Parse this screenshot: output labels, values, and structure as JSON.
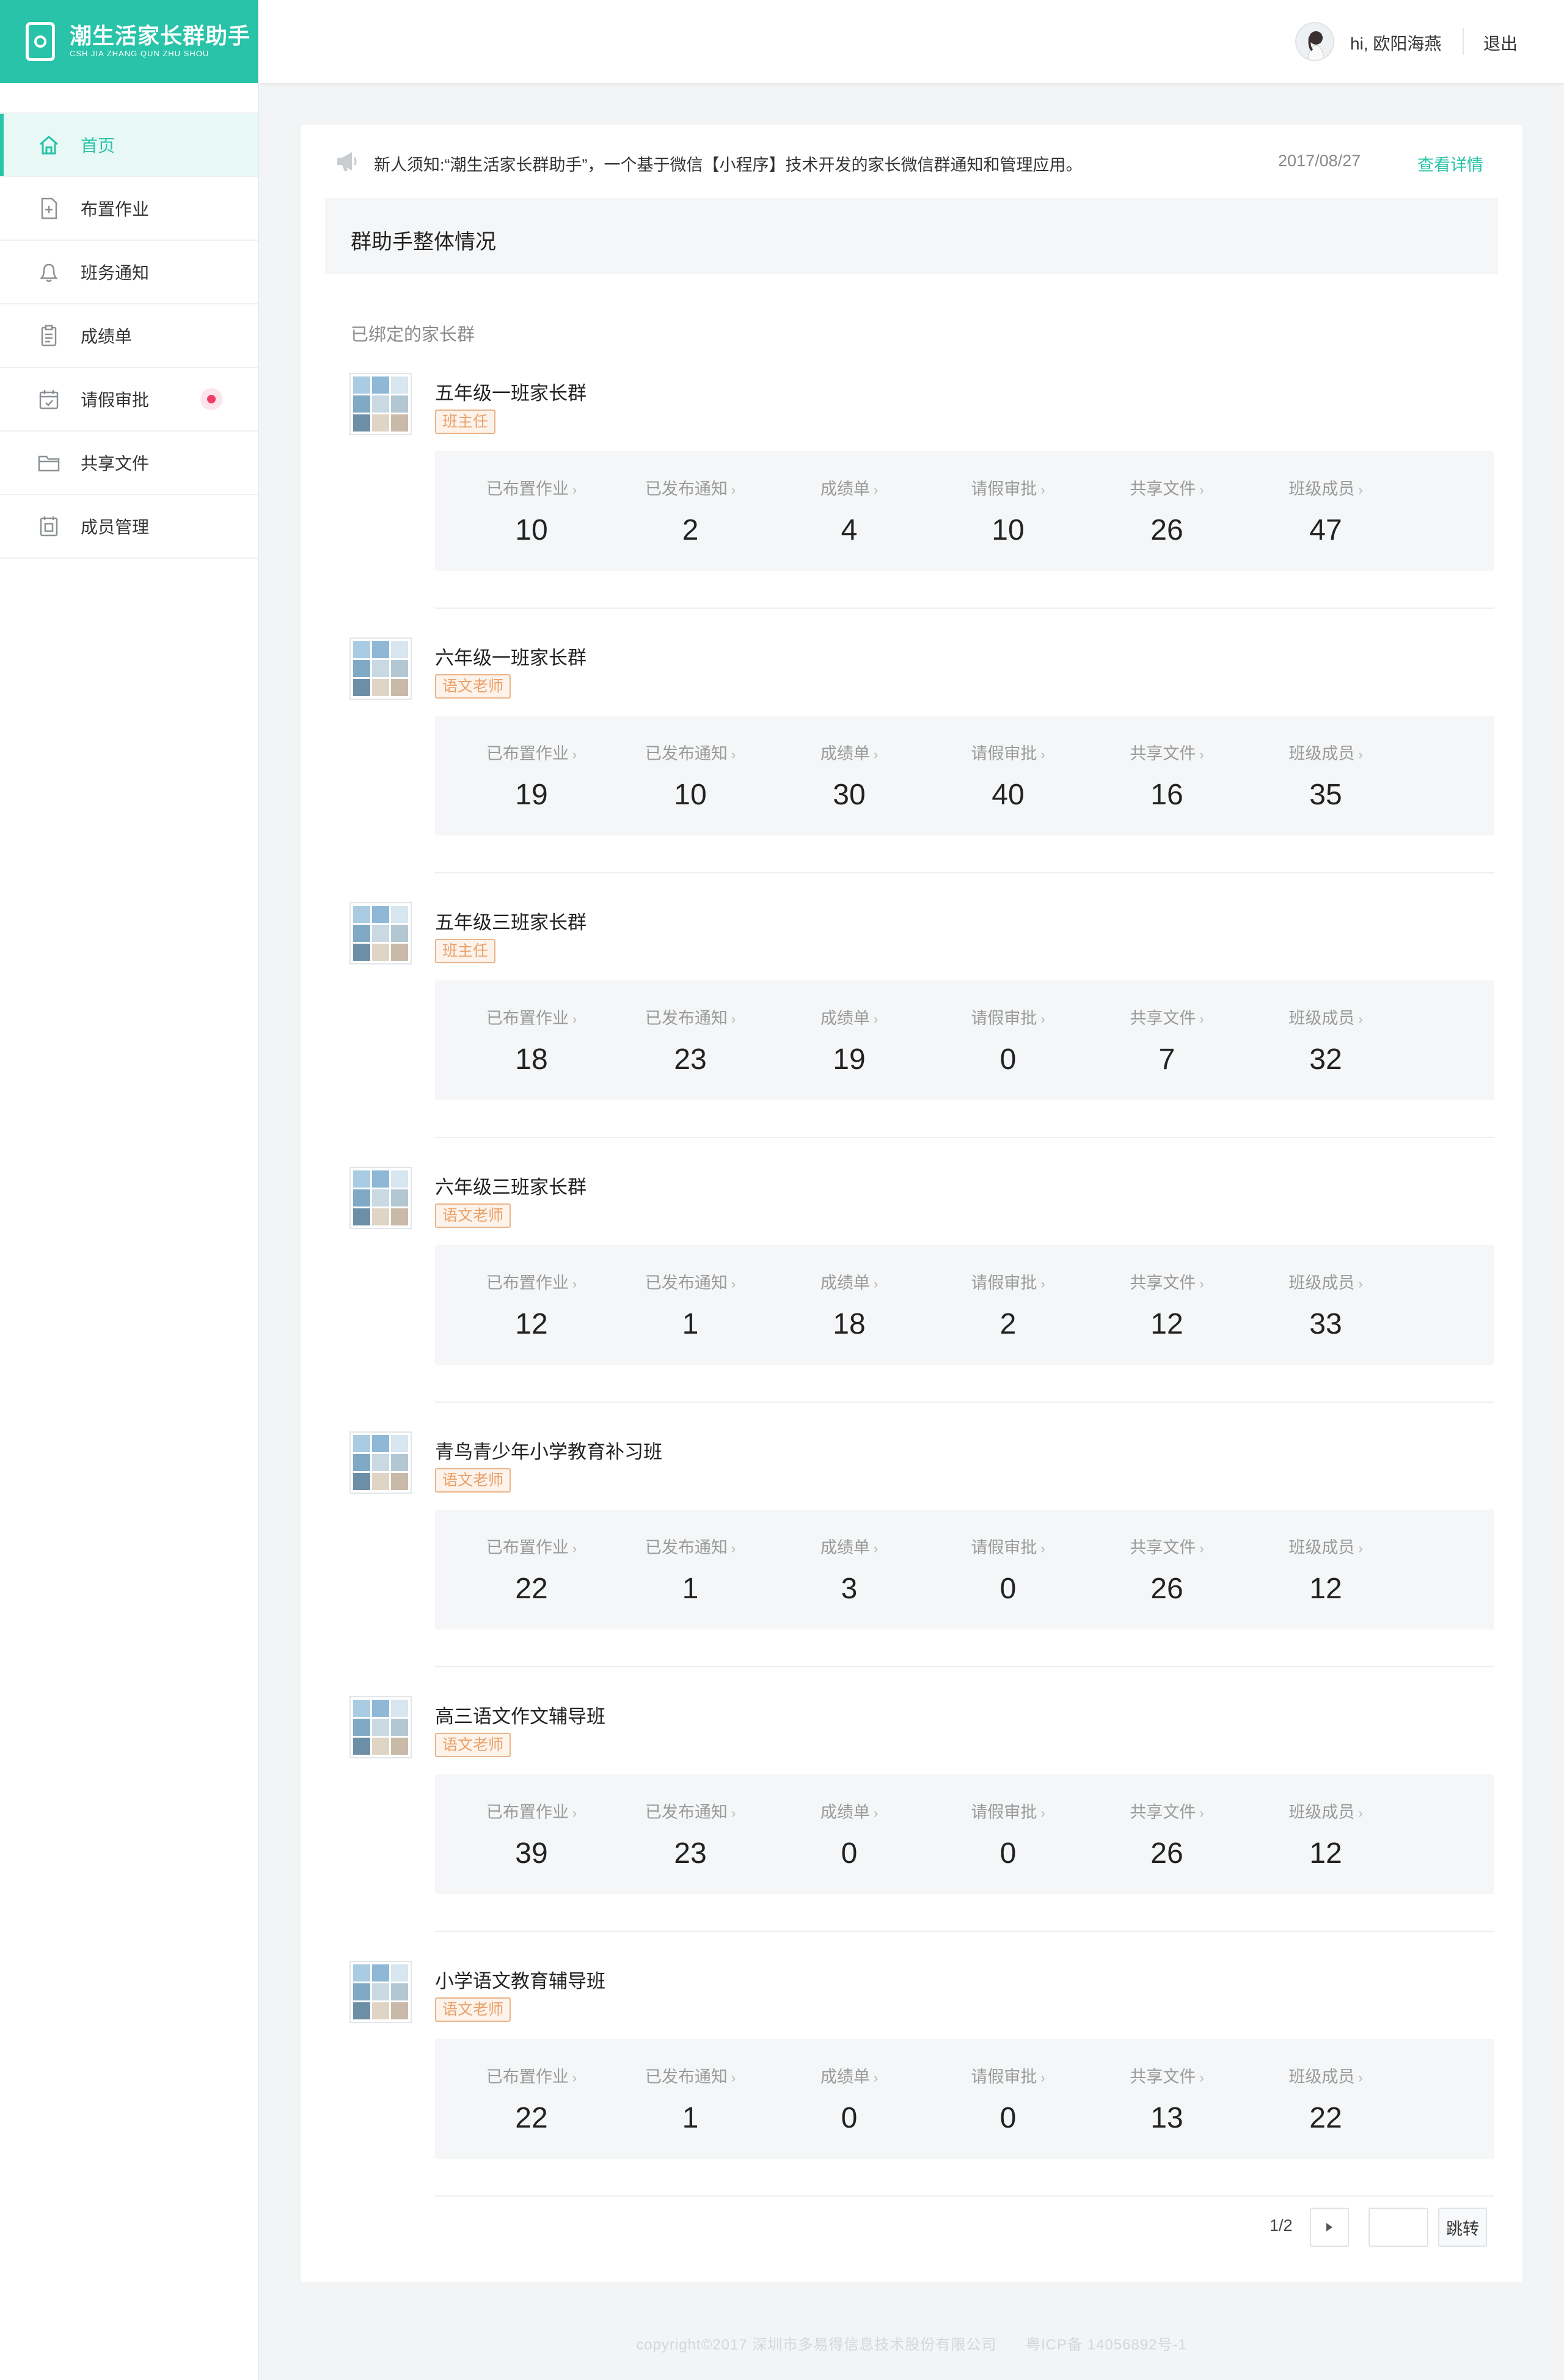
{
  "app": {
    "title": "潮生活家长群助手",
    "subtitle": "CSH JIA ZHANG QUN ZHU SHOU",
    "accent_color": "#28c3a8"
  },
  "sidebar": {
    "items": [
      {
        "label": "首页",
        "icon": "home-icon",
        "active": true
      },
      {
        "label": "布置作业",
        "icon": "add-document-icon",
        "active": false
      },
      {
        "label": "班务通知",
        "icon": "bell-icon",
        "active": false
      },
      {
        "label": "成绩单",
        "icon": "clipboard-icon",
        "active": false
      },
      {
        "label": "请假审批",
        "icon": "calendar-icon",
        "active": false,
        "badge": "red-dot"
      },
      {
        "label": "共享文件",
        "icon": "folder-icon",
        "active": false
      },
      {
        "label": "成员管理",
        "icon": "members-icon",
        "active": false
      }
    ]
  },
  "header": {
    "greeting": "hi, 欧阳海燕",
    "logout": "退出"
  },
  "notice": {
    "text": "新人须知:“潮生活家长群助手”，一个基于微信【小程序】技术开发的家长微信群通知和管理应用。",
    "date": "2017/08/27",
    "link": "查看详情"
  },
  "section": {
    "title": "群助手整体情况",
    "bound_label": "已绑定的家长群"
  },
  "stat_labels": [
    "已布置作业",
    "已发布通知",
    "成绩单",
    "请假审批",
    "共享文件",
    "班级成员"
  ],
  "groups": [
    {
      "name": "五年级一班家长群",
      "role": "班主任",
      "stats": [
        10,
        2,
        4,
        10,
        26,
        47
      ]
    },
    {
      "name": "六年级一班家长群",
      "role": "语文老师",
      "stats": [
        19,
        10,
        30,
        40,
        16,
        35
      ]
    },
    {
      "name": "五年级三班家长群",
      "role": "班主任",
      "stats": [
        18,
        23,
        19,
        0,
        7,
        32
      ]
    },
    {
      "name": "六年级三班家长群",
      "role": "语文老师",
      "stats": [
        12,
        1,
        18,
        2,
        12,
        33
      ]
    },
    {
      "name": "青鸟青少年小学教育补习班",
      "role": "语文老师",
      "stats": [
        22,
        1,
        3,
        0,
        26,
        12
      ]
    },
    {
      "name": "高三语文作文辅导班",
      "role": "语文老师",
      "stats": [
        39,
        23,
        0,
        0,
        26,
        12
      ]
    },
    {
      "name": "小学语文教育辅导班",
      "role": "语文老师",
      "stats": [
        22,
        1,
        0,
        0,
        13,
        22
      ]
    }
  ],
  "pager": {
    "info": "1/2",
    "next_icon": "triangle-right-icon",
    "jump": "跳转",
    "input_value": ""
  },
  "footer": {
    "copyright": "copyright©2017  深圳市多易得信息技术股份有限公司",
    "icp": "粤ICP备 14056892号-1"
  }
}
